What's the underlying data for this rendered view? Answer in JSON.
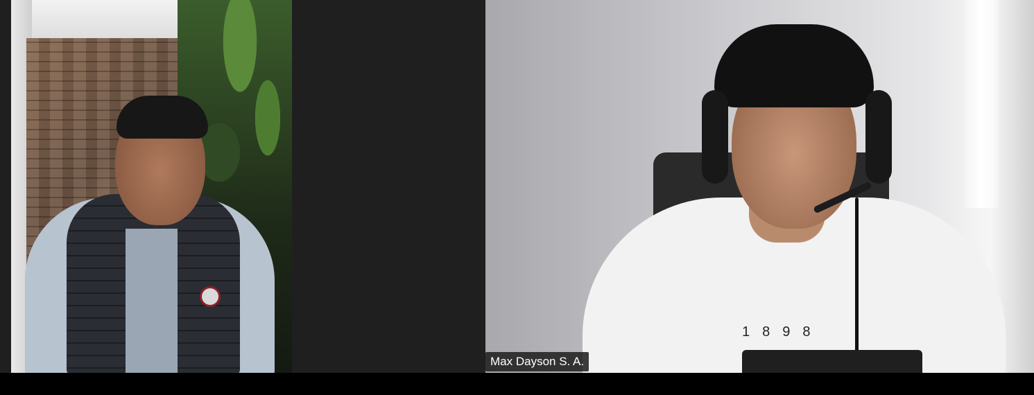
{
  "participants": [
    {
      "name": ""
    },
    {
      "name": "Max Dayson S. A."
    }
  ],
  "shirt_text": "1898"
}
